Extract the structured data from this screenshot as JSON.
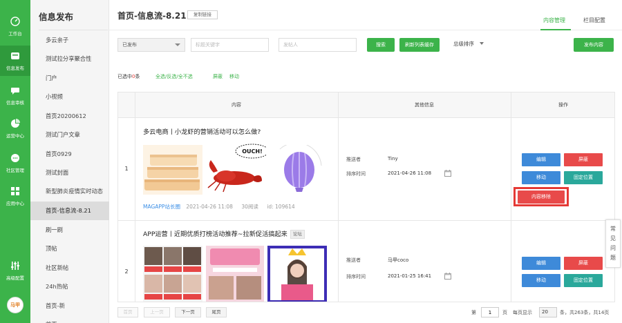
{
  "rail": {
    "items": [
      {
        "label": "工作台",
        "icon": "dashboard-icon"
      },
      {
        "label": "信息发布",
        "icon": "publish-icon"
      },
      {
        "label": "信息审核",
        "icon": "review-icon"
      },
      {
        "label": "运营中心",
        "icon": "operations-icon"
      },
      {
        "label": "社区管理",
        "icon": "community-icon"
      },
      {
        "label": "应用中心",
        "icon": "apps-icon"
      },
      {
        "label": "高级配置",
        "icon": "sliders-icon"
      }
    ],
    "avatar_text": "马甲"
  },
  "sidebar": {
    "title": "信息发布",
    "items": [
      {
        "label": "多云亲子"
      },
      {
        "label": "测试拉分享聚合性"
      },
      {
        "label": "门户"
      },
      {
        "label": "小视频"
      },
      {
        "label": "首页20200612"
      },
      {
        "label": "测试门户文章"
      },
      {
        "label": "首页0929"
      },
      {
        "label": "测试封面"
      },
      {
        "label": "新型肺炎疫情实时动态"
      },
      {
        "label": "首页-信息流-8.21"
      },
      {
        "label": "刷一刷"
      },
      {
        "label": "顶帖"
      },
      {
        "label": "社区新帖"
      },
      {
        "label": "24h热帖"
      },
      {
        "label": "首页-新"
      },
      {
        "label": "首页"
      }
    ]
  },
  "header": {
    "title": "首页-信息流-8.21",
    "copy_link": "复制链接",
    "tabs": [
      {
        "label": "内容管理"
      },
      {
        "label": "栏目配置"
      }
    ]
  },
  "filters": {
    "status": "已发布",
    "keyword_placeholder": "标题关键字",
    "author_placeholder": "发帖人",
    "search_btn": "搜索",
    "refresh_btn": "刷新列表缓存",
    "sort_label": "总级排序",
    "publish_btn": "发布内容"
  },
  "selection": {
    "prefix": "已选中",
    "count": "0",
    "suffix": "条",
    "select_all": "全选/反选/全不选",
    "hide": "屏蔽",
    "move": "移动"
  },
  "table": {
    "headers": {
      "content": "内容",
      "info": "其他信息",
      "ops": "操作"
    },
    "rows": [
      {
        "num": "1",
        "title": "多云电商丨小龙虾的营销活动可以怎么做?",
        "author": "MAGAPP站长圈",
        "date": "2021-04-26 11:08",
        "reads": "30阅读",
        "id": "id: 109614",
        "recommender_label": "推送者",
        "recommender": "Tiny",
        "time_label": "排序时间",
        "time": "2021-04-26 11:08",
        "thumb_text": "OUCH!",
        "actions": {
          "edit": "编辑",
          "hide": "屏蔽",
          "move": "移动",
          "pin": "固定位置",
          "remove": "内容移除"
        }
      },
      {
        "num": "2",
        "title": "APP运营丨近期优质打榜活动推荐~拉新促活搞起来",
        "tag": "论坛",
        "recommender_label": "推送者",
        "recommender": "马甲coco",
        "time_label": "排序时间",
        "time": "2021-01-25 16:41",
        "actions": {
          "edit": "编辑",
          "hide": "屏蔽",
          "move": "移动",
          "pin": "固定位置"
        }
      }
    ]
  },
  "faq": [
    "常",
    "见",
    "问",
    "题"
  ],
  "pagination": {
    "first": "首页",
    "prev": "上一页",
    "next": "下一页",
    "last": "尾页",
    "page_prefix": "第",
    "page": "1",
    "page_suffix": "页",
    "per_page_label": "每页显示",
    "per_page": "20",
    "summary": "条，共263条，共14页"
  },
  "colors": {
    "brand": "#3cb34a",
    "danger": "#e84a4a",
    "primary": "#3e8ad9",
    "teal": "#2aa89b"
  }
}
